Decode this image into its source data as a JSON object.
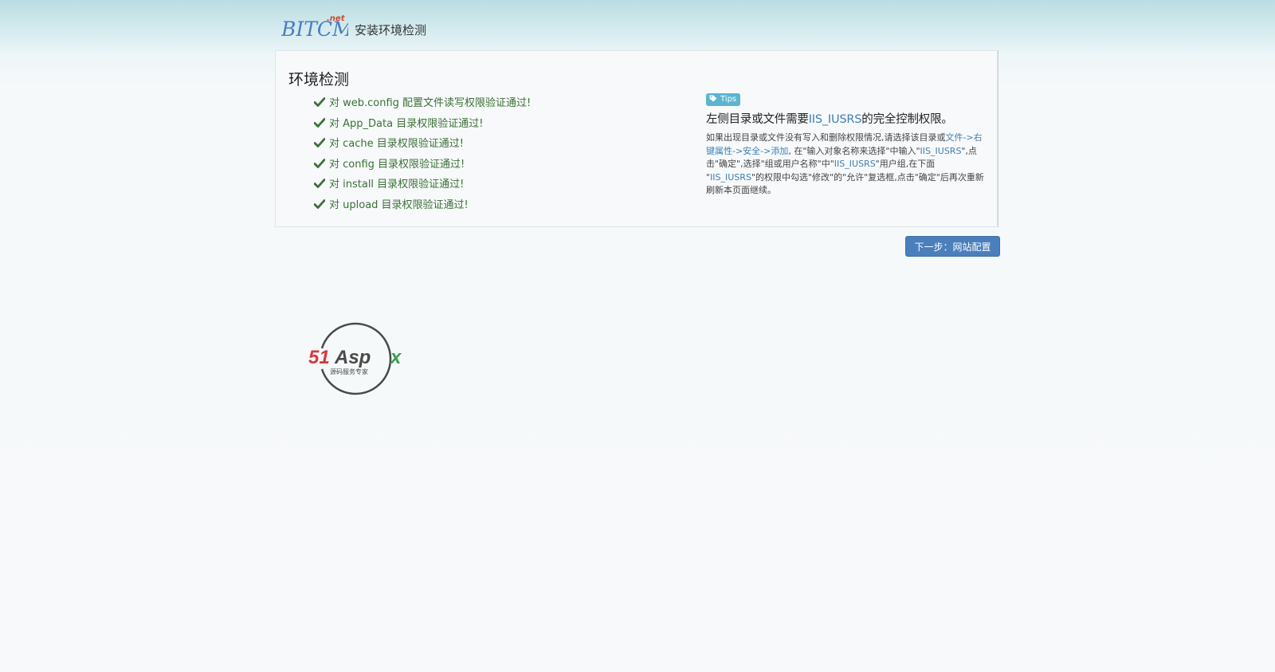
{
  "header": {
    "logo_main": "BITCMS",
    "logo_suffix": ".net",
    "title": "安装环境检测"
  },
  "panel": {
    "title": "环境检测",
    "checks": [
      "对 web.config 配置文件读写权限验证通过!",
      "对 App_Data 目录权限验证通过!",
      "对 cache 目录权限验证通过!",
      "对 config 目录权限验证通过!",
      "对 install 目录权限验证通过!",
      "对 upload 目录权限验证通过!"
    ]
  },
  "tips": {
    "badge": "Tips",
    "heading_prefix": "左侧目录或文件需要",
    "heading_link": "IIS_IUSRS",
    "heading_suffix": "的完全控制权限。",
    "body": {
      "p1": "如果出现目录或文件没有写入和删除权限情况,请选择该目录或",
      "l1": "文件->右键属性->安全->添加",
      "p2": ", 在\"输入对象名称来选择\"中输入\"",
      "l2": "IIS_IUSRS",
      "p3": "\",点击\"确定\",选择\"组或用户名称\"中\"",
      "l3": "IIS_IUSRS",
      "p4": "\"用户组,在下面 \"",
      "l4": "IIS_IUSRS",
      "p5": "\"的权限中勾选\"修改\"的\"允许\"复选框,点击\"确定\"后再次重新刷新本页面继续。"
    }
  },
  "next_button": {
    "label": "下一步：网站配置"
  },
  "footer_logo": {
    "brand": "51Aspx",
    "tagline": "源码服务专家"
  },
  "colors": {
    "success": "#3b7034",
    "link": "#3f7fb3",
    "badge": "#5bb5d0",
    "button": "#4a7fbc",
    "logo_red": "#d23a3f",
    "logo_green": "#3aa14a"
  },
  "icons": {
    "check": "check-icon",
    "tag": "tag-icon"
  }
}
